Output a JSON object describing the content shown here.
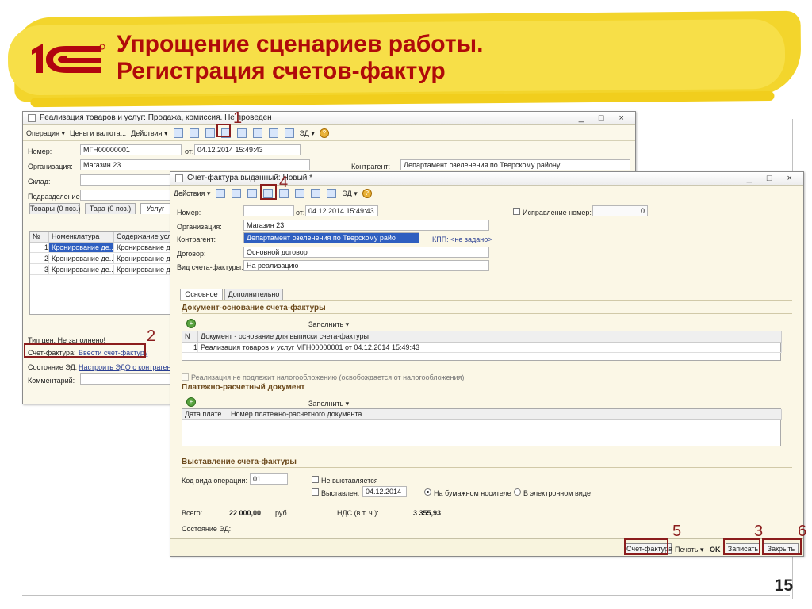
{
  "header": {
    "title_line1": "Упрощение сценариев работы.",
    "title_line2": "Регистрация счетов-фактур",
    "logo_text": "1С",
    "page_number": "15"
  },
  "window1": {
    "title": "Реализация товаров и услуг: Продажа, комиссия. Не проведен",
    "toolbar": {
      "operation": "Операция ▾",
      "prices": "Цены и валюта...",
      "actions": "Действия ▾",
      "edi": "ЭД ▾"
    },
    "fields": {
      "number_label": "Номер:",
      "number_value": "МГН00000001",
      "from_label": "от:",
      "date_value": "04.12.2014 15:49:43",
      "org_label": "Организация:",
      "org_value": "Магазин 23",
      "contractor_label": "Контрагент:",
      "contractor_value": "Департамент озеленения по Тверскому району",
      "warehouse_label": "Склад:",
      "division_label": "Подразделение:"
    },
    "tabs": [
      "Товары (0 поз.)",
      "Тара (0 поз.)",
      "Услуг"
    ],
    "table": {
      "columns": [
        "№",
        "Номенклатура",
        "Содержание услу"
      ],
      "rows": [
        [
          "1",
          "Кронирование де...",
          "Кронирование де"
        ],
        [
          "2",
          "Кронирование де...",
          "Кронирование де"
        ],
        [
          "3",
          "Кронирование де...",
          "Кронирование де"
        ]
      ]
    },
    "price_type": "Тип цен: Не заполнено!",
    "invoice_label": "Счет-фактура:",
    "invoice_link": "Ввести счет-фактуру",
    "edo_label": "Состояние ЭД:",
    "edo_link": "Настроить ЭДО с контрагент",
    "comment_label": "Комментарий:"
  },
  "window2": {
    "title": "Счет-фактура выданный: Новый *",
    "toolbar": {
      "actions": "Действия ▾",
      "edi": "ЭД ▾"
    },
    "fields": {
      "number_label": "Номер:",
      "from_label": "от:",
      "date_value": "04.12.2014 15:49:43",
      "correction_label": "Исправление номер:",
      "correction_value": "0",
      "org_label": "Организация:",
      "org_value": "Магазин 23",
      "contractor_label": "Контрагент:",
      "contractor_value": "Департамент озеленения по Тверскому райо",
      "kpp_link": "КПП: <не задано>",
      "contract_label": "Договор:",
      "contract_value": "Основной договор",
      "invoice_type_label": "Вид счета-фактуры:",
      "invoice_type_value": "На реализацию"
    },
    "tabs": [
      "Основное",
      "Дополнительно"
    ],
    "doc_base": {
      "title": "Документ-основание счета-фактуры",
      "fill_button": "Заполнить ▾",
      "columns": [
        "N",
        "Документ - основание для выписки счета-фактуры"
      ],
      "rows": [
        [
          "1",
          "Реализация товаров и услуг МГН00000001 от 04.12.2014 15:49:43"
        ]
      ]
    },
    "exempt_checkbox": "Реализация не подлежит налогообложению (освобождается от налогообложения)",
    "payment_doc": {
      "title": "Платежно-расчетный документ",
      "fill_button": "Заполнить ▾",
      "columns": [
        "Дата плате...",
        "Номер платежно-расчетного документа"
      ]
    },
    "issue": {
      "title": "Выставление счета-фактуры",
      "operation_code_label": "Код вида операции:",
      "operation_code_value": "01",
      "not_issued_label": "Не выставляется",
      "issued_label": "Выставлен:",
      "issued_date": "04.12.2014",
      "paper_label": "На бумажном носителе",
      "electronic_label": "В электронном виде",
      "total_label": "Всего:",
      "total_value": "22 000,00",
      "currency": "руб.",
      "vat_label": "НДС (в т. ч.):",
      "vat_value": "3 355,93",
      "edo_label": "Состояние ЭД:"
    },
    "bottom": {
      "invoice": "Счет-фактура",
      "print": "Печать ▾",
      "ok": "OK",
      "save": "Записать",
      "close": "Закрыть"
    }
  },
  "callouts": [
    "1",
    "2",
    "3",
    "4",
    "5",
    "6"
  ]
}
